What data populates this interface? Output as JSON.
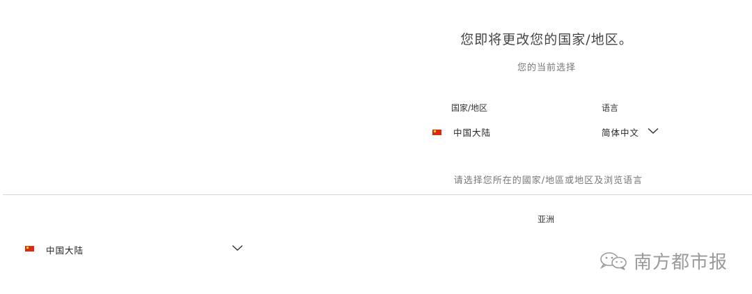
{
  "header": {
    "title": "您即将更改您的国家/地区。",
    "subtitle": "您的当前选择"
  },
  "current_selection": {
    "country_label": "国家/地区",
    "language_label": "语言",
    "country": "中国大陆",
    "country_flag_icon": "china-flag-icon",
    "language": "简体中文"
  },
  "instruction": "请选择您所在的國家/地區或地区及浏览语言",
  "region": {
    "name": "亚洲",
    "country_select": "中国大陆"
  },
  "watermark": {
    "text": "南方都市报",
    "icon": "wechat-icon"
  },
  "colors": {
    "flag_red": "#de2910",
    "flag_star": "#ffde00",
    "divider": "#d6d6d6",
    "watermark": "#9a9a9a"
  }
}
